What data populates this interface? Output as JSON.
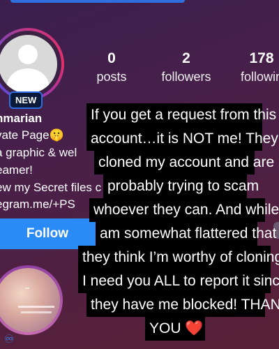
{
  "profile": {
    "badge": "NEW",
    "stats": [
      {
        "value": "0",
        "label": "posts"
      },
      {
        "value": "2",
        "label": "followers"
      },
      {
        "value": "178",
        "label": "followin"
      }
    ],
    "bio": [
      "nmarian",
      "vate Page🤫",
      "a graphic & wel",
      "eamer!",
      "ew my Secret files c",
      "egram.me/+PS"
    ],
    "follow_label": "Follow"
  },
  "caption": {
    "lines": [
      "If you get a request from this",
      "account…it is NOT me! They e",
      "cloned my account and are",
      "probably trying to scam",
      "whoever they can. And while I",
      "am somewhat flattered that",
      "they think I’m worthy of cloning,",
      "I need you ALL to report it since",
      "they have me blocked! THANK",
      "YOU ❤️"
    ]
  },
  "colors": {
    "accent": "#2a8af6",
    "badge_border": "#2f6fe0",
    "caption_bg": "#000000"
  }
}
